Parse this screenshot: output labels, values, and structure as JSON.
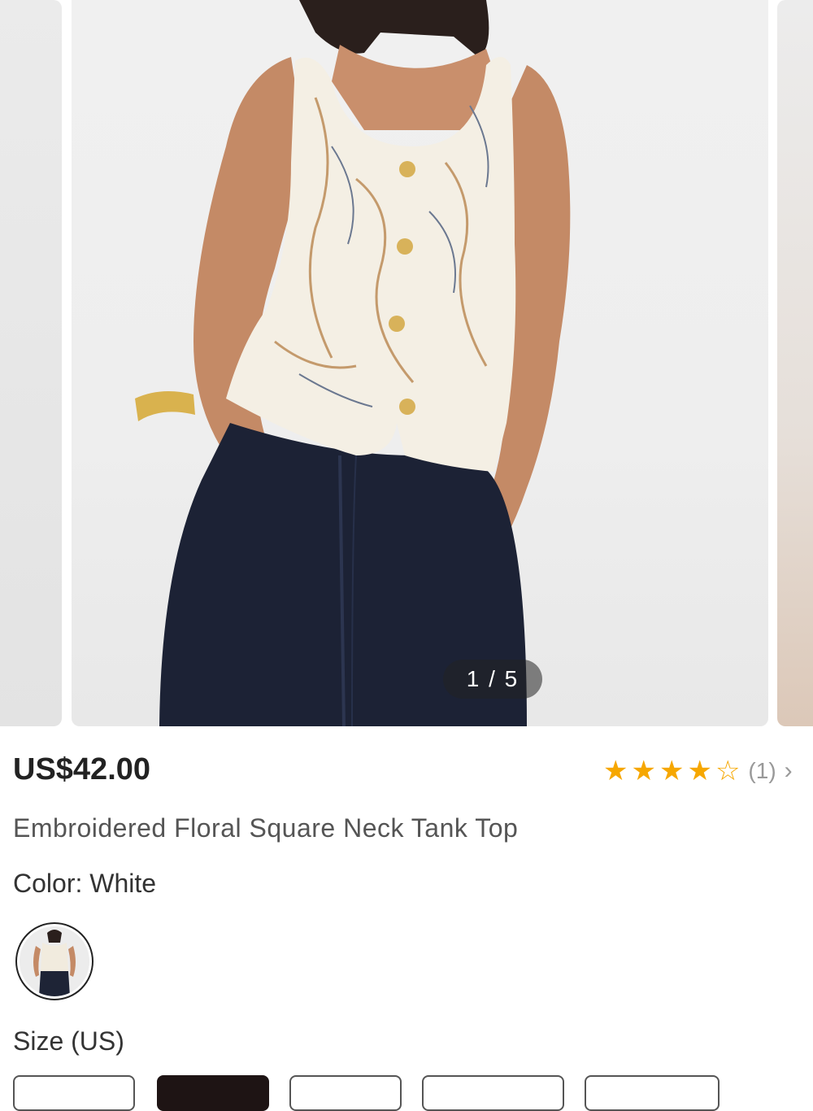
{
  "gallery": {
    "counter": "1 / 5",
    "main_image_alt": "Model wearing embroidered floral square neck tank top with dark jeans"
  },
  "product": {
    "price": "US$42.00",
    "rating": {
      "stars": 4,
      "max": 5,
      "count": "(1)"
    },
    "title": "Embroidered Floral Square Neck Tank Top",
    "color_label": "Color: White",
    "size_label": "Size (US)"
  },
  "colors": {
    "star": "#f6a700",
    "selected_size": "#1e1414"
  }
}
